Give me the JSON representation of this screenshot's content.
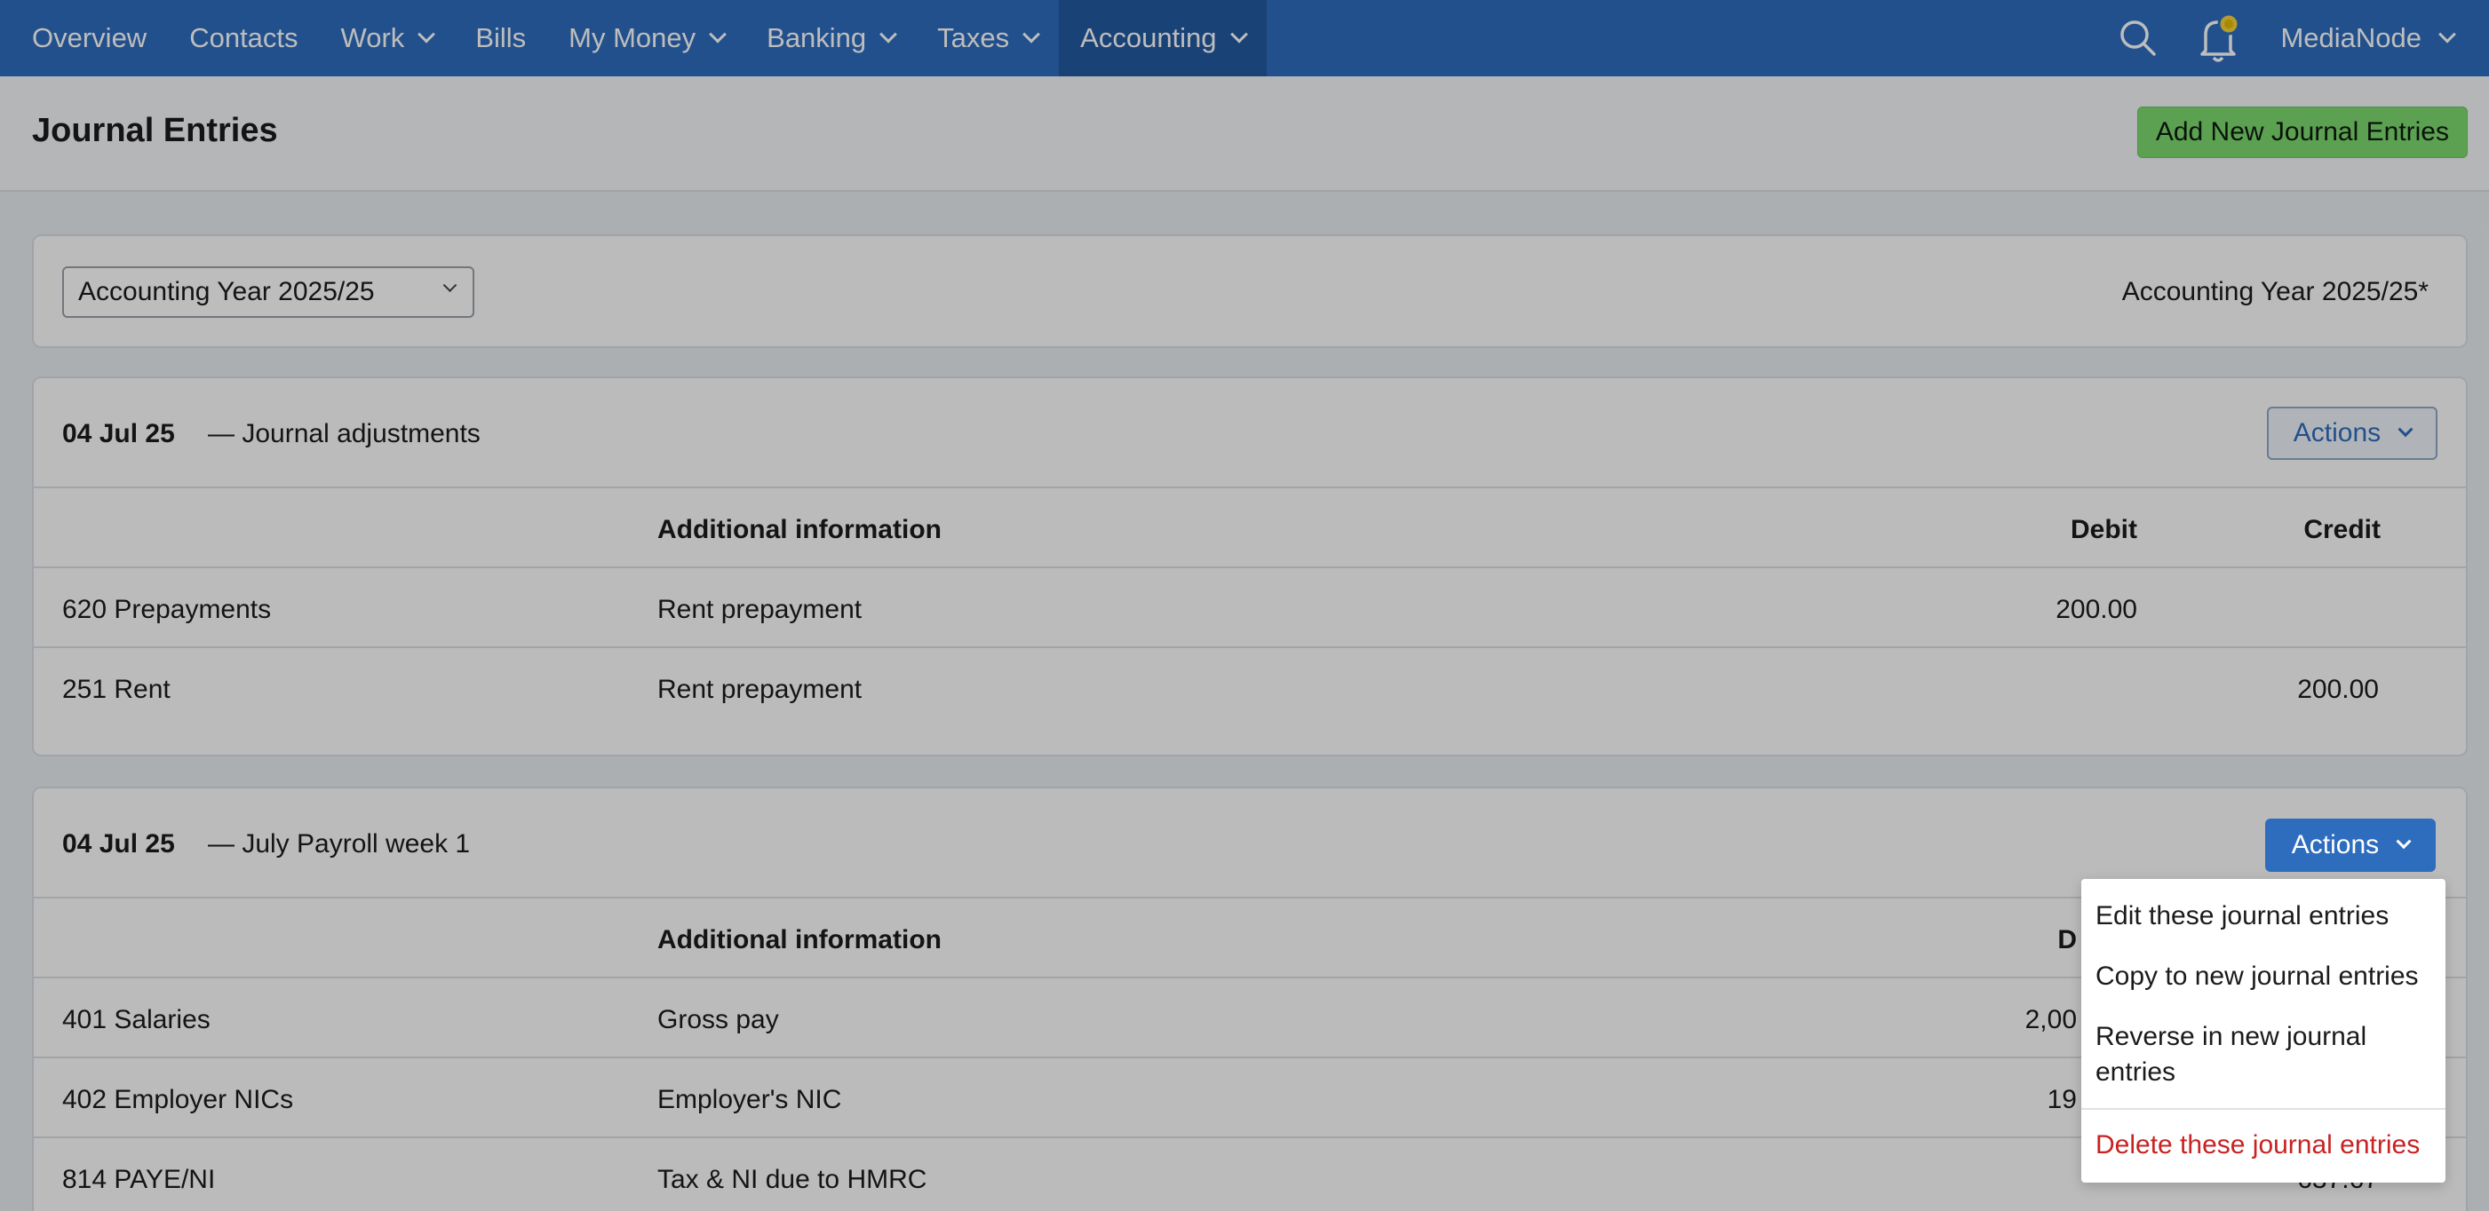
{
  "nav": {
    "items": [
      {
        "label": "Overview",
        "dropdown": false
      },
      {
        "label": "Contacts",
        "dropdown": false
      },
      {
        "label": "Work",
        "dropdown": true
      },
      {
        "label": "Bills",
        "dropdown": false
      },
      {
        "label": "My Money",
        "dropdown": true
      },
      {
        "label": "Banking",
        "dropdown": true
      },
      {
        "label": "Taxes",
        "dropdown": true
      },
      {
        "label": "Accounting",
        "dropdown": true,
        "active": true
      }
    ],
    "account_name": "MediaNode",
    "icons": [
      "search-icon",
      "bell-icon"
    ]
  },
  "page": {
    "title": "Journal Entries",
    "add_button": "Add New Journal Entries"
  },
  "year": {
    "select_value": "Accounting Year 2025/25",
    "label": "Accounting Year 2025/25*"
  },
  "table_headers": {
    "additional_info": "Additional information",
    "debit": "Debit",
    "credit": "Credit"
  },
  "entries": [
    {
      "date": "04 Jul 25",
      "description": "— Journal adjustments",
      "actions_label": "Actions",
      "rows": [
        {
          "account": "620 Prepayments",
          "info": "Rent prepayment",
          "debit": "200.00",
          "credit": ""
        },
        {
          "account": "251 Rent",
          "info": "Rent prepayment",
          "debit": "",
          "credit": "200.00"
        }
      ]
    },
    {
      "date": "04 Jul 25",
      "description": "— July Payroll week 1",
      "actions_label": "Actions",
      "rows": [
        {
          "account": "401 Salaries",
          "info": "Gross pay",
          "debit": "2,00",
          "credit": ""
        },
        {
          "account": "402 Employer NICs",
          "info": "Employer's NIC",
          "debit": "19",
          "credit": ""
        },
        {
          "account": "814 PAYE/NI",
          "info": "Tax & NI due to HMRC",
          "debit": "",
          "credit": "637.67"
        }
      ],
      "header_debit_partial": "D"
    }
  ],
  "actions_menu": {
    "items": [
      "Edit these journal entries",
      "Copy to new journal entries",
      "Reverse in new journal entries",
      "Delete these journal entries"
    ]
  },
  "colors": {
    "nav_bg": "#2e6dbd",
    "add_button": "#7dd96f",
    "danger": "#c82222"
  }
}
